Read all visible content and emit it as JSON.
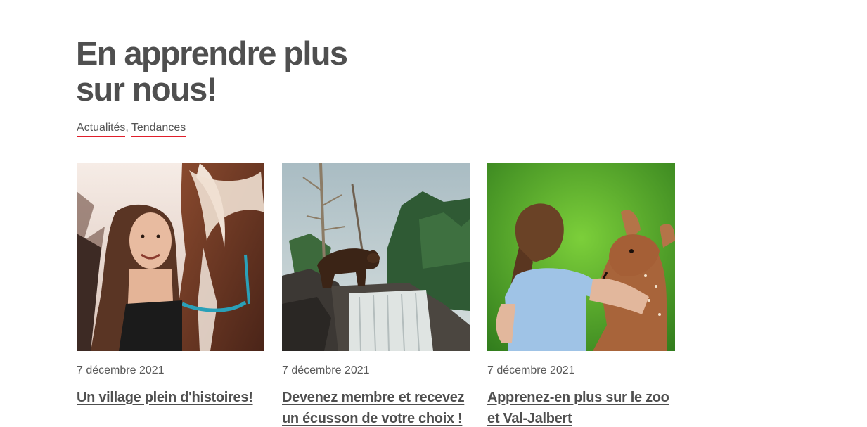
{
  "section": {
    "title_line1": "En apprendre plus",
    "title_line2": "sur nous!",
    "categories": [
      {
        "label": "Actualités",
        "sep": ","
      },
      {
        "label": "Tendances",
        "sep": ""
      }
    ]
  },
  "colors": {
    "accent": "#e01e2b",
    "text": "#4f4f4f"
  },
  "posts": [
    {
      "date": "7 décembre 2021",
      "title": "Un village plein d'histoires!",
      "image": "girl-with-horse-photo"
    },
    {
      "date": "7 décembre 2021",
      "title": "Devenez membre et recevez un écusson de votre choix !",
      "image": "bear-on-waterfall-photo"
    },
    {
      "date": "7 décembre 2021",
      "title": "Apprenez-en plus sur le zoo et Val-Jalbert",
      "image": "girl-with-fawn-photo"
    }
  ]
}
